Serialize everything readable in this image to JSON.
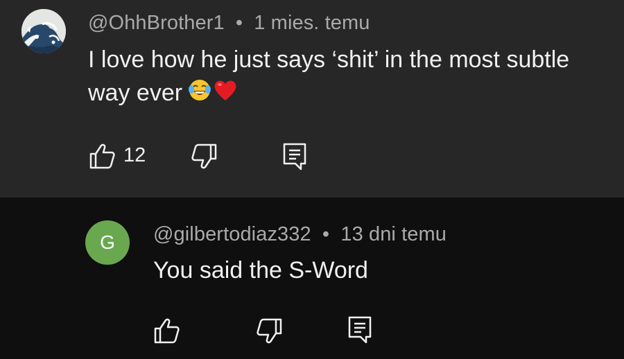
{
  "comments": [
    {
      "author": "@OhhBrother1",
      "separator": "•",
      "time": "1 mies. temu",
      "text_line1": "I love how he just says ‘shit’ in the most subtle",
      "text_line2": "way ever",
      "emojis": [
        "face-with-tears-of-joy",
        "red-heart"
      ],
      "likes": "12",
      "avatar_icon": "great-wave-avatar-icon"
    },
    {
      "author": "@gilbertodiaz332",
      "separator": "•",
      "time": "13 dni temu",
      "text": "You said the S-Word",
      "avatar_letter": "G",
      "avatar_color": "#6aa84f"
    }
  ],
  "colors": {
    "top_bg": "#272727",
    "bottom_bg": "#0f0f0f",
    "meta_text": "#aaaaaa",
    "body_text": "#f1f1f1"
  }
}
